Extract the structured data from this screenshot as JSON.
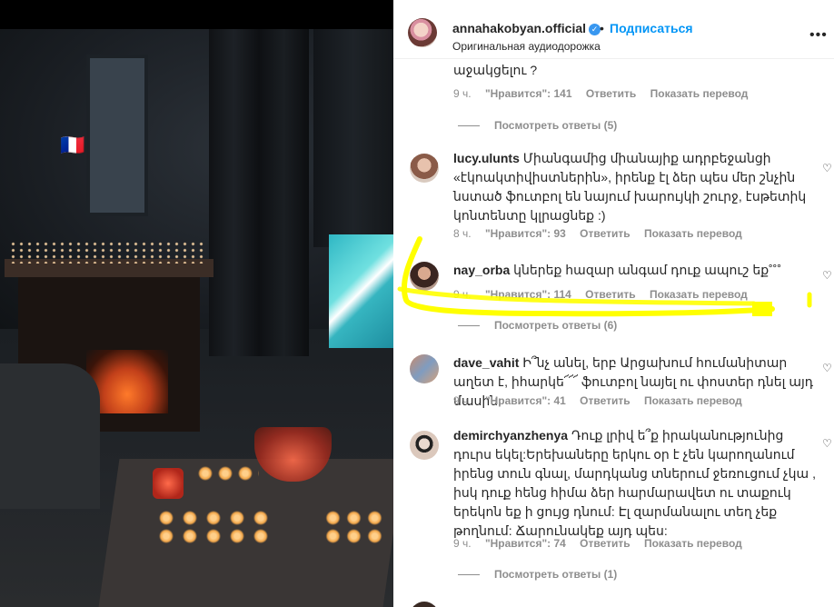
{
  "post": {
    "flag": "🇫🇷"
  },
  "header": {
    "username": "annahakobyan.official",
    "dot": "•",
    "follow_label": "Подписаться",
    "subtitle": "Оригинальная аудиодорожка",
    "more_icon": "more-horizontal-icon"
  },
  "comments": [
    {
      "text_tail": "աջակցելու ?",
      "time": "9 ч.",
      "likes": "\"Нравится\": 141",
      "reply": "Ответить",
      "translate": "Показать перевод",
      "view_replies": "Посмотреть ответы (5)"
    },
    {
      "username": "lucy.ulunts",
      "text": "Միանգամից միանայիք ադրբեջանցի «էկոակտիվիստներին», իրենք էլ ձեր պես մեր շնչին նստած ֆուտբոլ են նայում խարույկի շուրջ, էսթետիկ կոնտենտը կլրացնեք :)",
      "time": "8 ч.",
      "likes": "\"Нравится\": 93",
      "reply": "Ответить",
      "translate": "Показать перевод"
    },
    {
      "username": "nay_orba",
      "text": "կներեք հազար անգամ դուք ապուշ եք˚˚˚",
      "time": "9 ч.",
      "likes": "\"Нравится\": 114",
      "reply": "Ответить",
      "translate": "Показать перевод",
      "view_replies": "Посмотреть ответы (6)"
    },
    {
      "username": "dave_vahit",
      "text": "Ի՞նչ անել, երբ Արցախում հումանիտար աղետ է, իհարկե՜՜՜ ֆուտբոլ նայել ու փոստեր դնել այդ մասին:",
      "time": "9 ч.",
      "likes": "\"Нравится\": 41",
      "reply": "Ответить",
      "translate": "Показать перевод"
    },
    {
      "username": "demirchyanzhenya",
      "text": "Դուք լրիվ ե՞ք իրականությունից դուրս եկել:Երեխաները երկու օր է չեն կարողանում իրենց տուն գնալ, մարդկանց տներում ջեռուցում չկա , իսկ դուք հենց հիմա ձեր հարմարավետ ու տաքուկ երեկոն եք ի ցույց դնում: Էլ զարմանալու տեղ չեք թողնում: Ճարունակեք այդ պես:",
      "time": "9 ч.",
      "likes": "\"Нравится\": 74",
      "reply": "Ответить",
      "translate": "Показать перевод",
      "view_replies": "Посмотреть ответы (1)"
    }
  ],
  "colors": {
    "annotation": "#ffff00",
    "link_blue": "#0095f6",
    "verified_blue": "#3897f0",
    "meta_gray": "#8e8e8e",
    "text": "#262626"
  }
}
